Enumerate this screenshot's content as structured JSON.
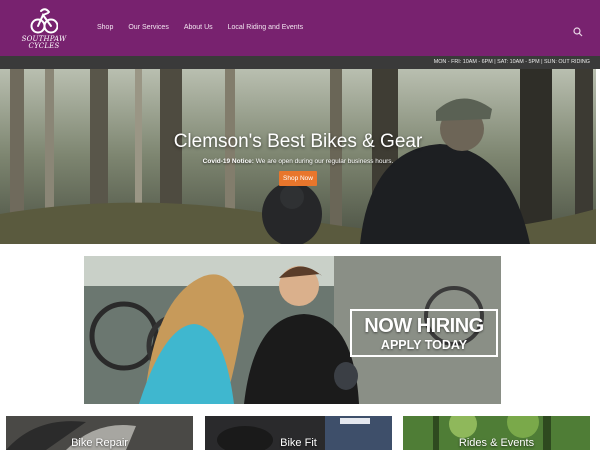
{
  "brand": {
    "name": "SouthPaw Cycles",
    "logo_text": "SOUTHPAW CYCLES",
    "color": "#78226f"
  },
  "nav": {
    "items": [
      "Shop",
      "Our Services",
      "About Us",
      "Local Riding and Events"
    ]
  },
  "search": {
    "icon": "search-icon"
  },
  "hours": {
    "text": "MON - FRI: 10AM - 6PM | SAT: 10AM - 5PM | SUN: OUT RIDING"
  },
  "hero": {
    "title": "Clemson's Best Bikes & Gear",
    "notice_label": "Covid-19 Notice:",
    "notice_text": " We are open during our regular business hours.",
    "button": "Shop Now",
    "button_color": "#e8762c"
  },
  "hiring": {
    "line1": "NOW HIRING",
    "line2": "APPLY TODAY"
  },
  "cards": [
    "Bike Repair",
    "Bike Fit",
    "Rides & Events"
  ],
  "colors": {
    "hours_bar": "#3a3a3a"
  }
}
